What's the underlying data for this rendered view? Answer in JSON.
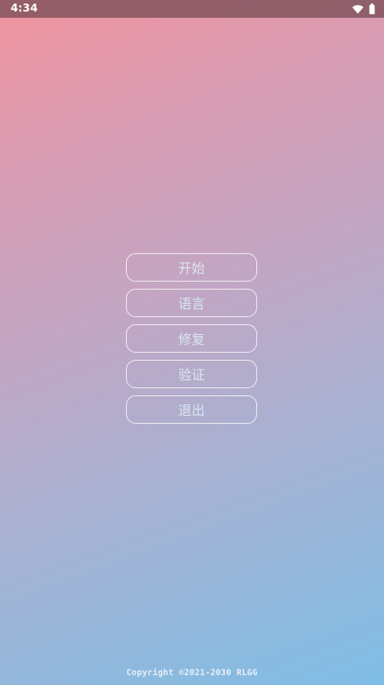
{
  "status_bar": {
    "time": "4:34",
    "wifi_icon": "wifi-icon",
    "battery_icon": "battery-icon"
  },
  "menu": {
    "items": [
      {
        "label": "开始"
      },
      {
        "label": "语言"
      },
      {
        "label": "修复"
      },
      {
        "label": "验证"
      },
      {
        "label": "退出"
      }
    ]
  },
  "footer": {
    "copyright": "Copyright ©2021-2030 RLGG"
  },
  "colors": {
    "gradient_top": "#f2949f",
    "gradient_bottom": "#7fbde6",
    "button_border": "#ffffff"
  }
}
